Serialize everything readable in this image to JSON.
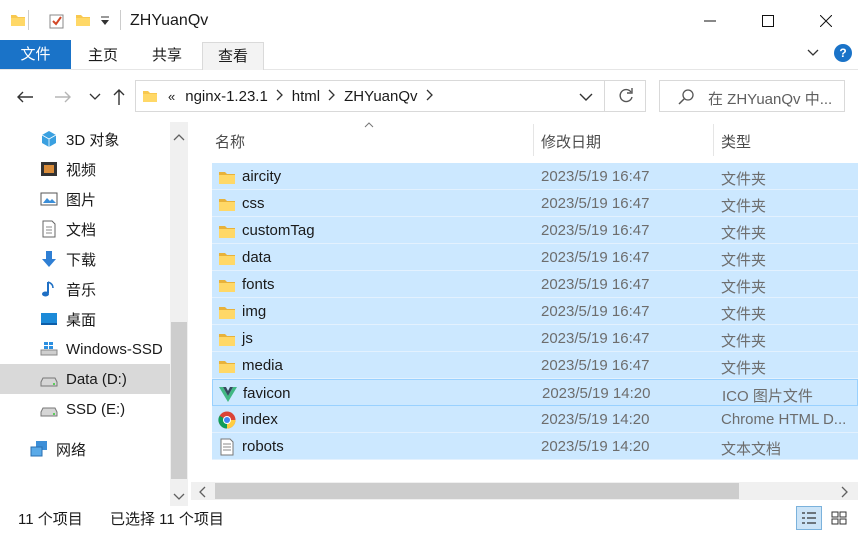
{
  "window": {
    "title": "ZHYuanQv",
    "minimize_label": "minimize",
    "maximize_label": "maximize",
    "close_label": "close"
  },
  "ribbon": {
    "tabs": [
      {
        "label": "文件",
        "active": true
      },
      {
        "label": "主页",
        "active": false
      },
      {
        "label": "共享",
        "active": false
      },
      {
        "label": "查看",
        "active": false
      }
    ],
    "help": "?"
  },
  "nav": {
    "breadcrumb_overflow": "«",
    "breadcrumbs": [
      "nginx-1.23.1",
      "html",
      "ZHYuanQv"
    ],
    "search_placeholder": "在 ZHYuanQv 中..."
  },
  "sidebar": {
    "items": [
      {
        "label": "3D 对象",
        "icon": "3d-objects-icon"
      },
      {
        "label": "视频",
        "icon": "video-icon"
      },
      {
        "label": "图片",
        "icon": "pictures-icon"
      },
      {
        "label": "文档",
        "icon": "documents-icon"
      },
      {
        "label": "下载",
        "icon": "download-icon"
      },
      {
        "label": "音乐",
        "icon": "music-icon"
      },
      {
        "label": "桌面",
        "icon": "desktop-icon"
      },
      {
        "label": "Windows-SSD",
        "icon": "windows-drive-icon"
      },
      {
        "label": "Data (D:)",
        "icon": "drive-icon",
        "selected": true
      },
      {
        "label": "SSD (E:)",
        "icon": "drive-icon"
      },
      {
        "label": "网络",
        "icon": "network-icon"
      }
    ]
  },
  "columns": {
    "name": "名称",
    "date": "修改日期",
    "type": "类型"
  },
  "files": [
    {
      "name": "aircity",
      "date": "2023/5/19 16:47",
      "type": "文件夹",
      "icon": "folder-icon"
    },
    {
      "name": "css",
      "date": "2023/5/19 16:47",
      "type": "文件夹",
      "icon": "folder-icon"
    },
    {
      "name": "customTag",
      "date": "2023/5/19 16:47",
      "type": "文件夹",
      "icon": "folder-icon"
    },
    {
      "name": "data",
      "date": "2023/5/19 16:47",
      "type": "文件夹",
      "icon": "folder-icon"
    },
    {
      "name": "fonts",
      "date": "2023/5/19 16:47",
      "type": "文件夹",
      "icon": "folder-icon"
    },
    {
      "name": "img",
      "date": "2023/5/19 16:47",
      "type": "文件夹",
      "icon": "folder-icon"
    },
    {
      "name": "js",
      "date": "2023/5/19 16:47",
      "type": "文件夹",
      "icon": "folder-icon"
    },
    {
      "name": "media",
      "date": "2023/5/19 16:47",
      "type": "文件夹",
      "icon": "folder-icon"
    },
    {
      "name": "favicon",
      "date": "2023/5/19 14:20",
      "type": "ICO 图片文件",
      "icon": "vue-logo-icon"
    },
    {
      "name": "index",
      "date": "2023/5/19 14:20",
      "type": "Chrome HTML D...",
      "icon": "chrome-icon"
    },
    {
      "name": "robots",
      "date": "2023/5/19 14:20",
      "type": "文本文档",
      "icon": "text-file-icon"
    }
  ],
  "status": {
    "count": "11 个项目",
    "selected": "已选择 11 个项目"
  },
  "colors": {
    "accent": "#1a73c8",
    "selection": "#cce8ff",
    "folder": "#f8c84f"
  }
}
